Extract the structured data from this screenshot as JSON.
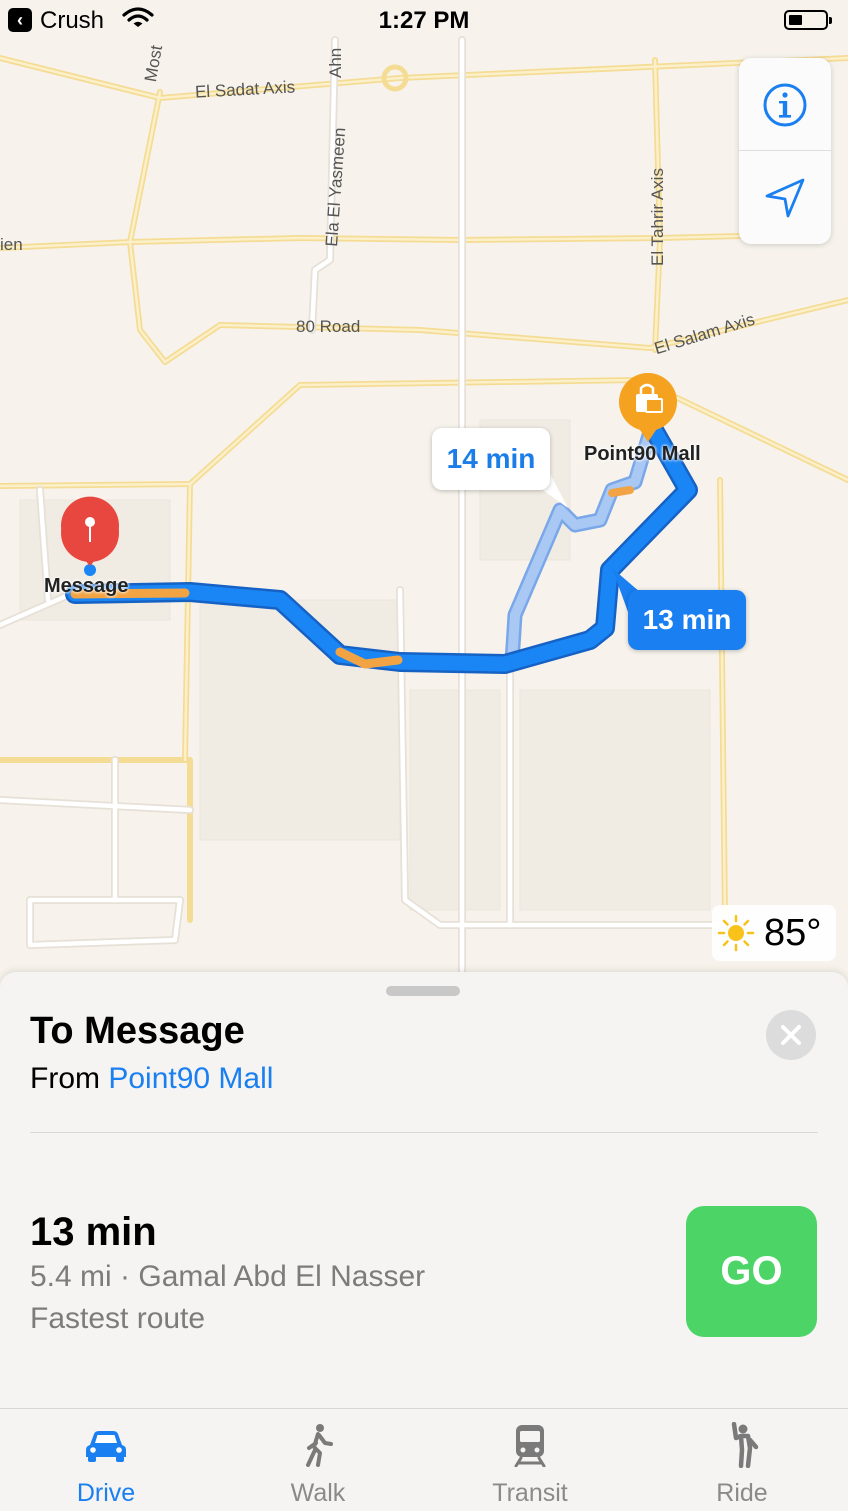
{
  "status_bar": {
    "back_app": "Crush",
    "time": "1:27 PM"
  },
  "map": {
    "road_labels": [
      "Most",
      "Ahn",
      "El Sadat Axis",
      "Ela El Yasmeen",
      "ien",
      "80 Road",
      "El Tahrir Axis",
      "El Salam Axis"
    ],
    "route_callouts": {
      "alternate": "14 min",
      "primary": "13 min"
    },
    "origin_label": "Point90 Mall",
    "destination_label": "Message",
    "weather": {
      "icon": "sun-icon",
      "temperature": "85°"
    },
    "route_color": "#1a7ff0",
    "traffic_color": "#f2a444"
  },
  "sheet": {
    "title": "To Message",
    "from_prefix": "From ",
    "from_place": "Point90 Mall",
    "route": {
      "eta": "13 min",
      "description": "5.4 mi · Gamal Abd El Nasser",
      "note": "Fastest route"
    },
    "go_label": "GO"
  },
  "tabs": [
    {
      "label": "Drive",
      "icon": "car-icon",
      "active": true
    },
    {
      "label": "Walk",
      "icon": "walk-icon",
      "active": false
    },
    {
      "label": "Transit",
      "icon": "train-icon",
      "active": false
    },
    {
      "label": "Ride",
      "icon": "ride-icon",
      "active": false
    }
  ]
}
